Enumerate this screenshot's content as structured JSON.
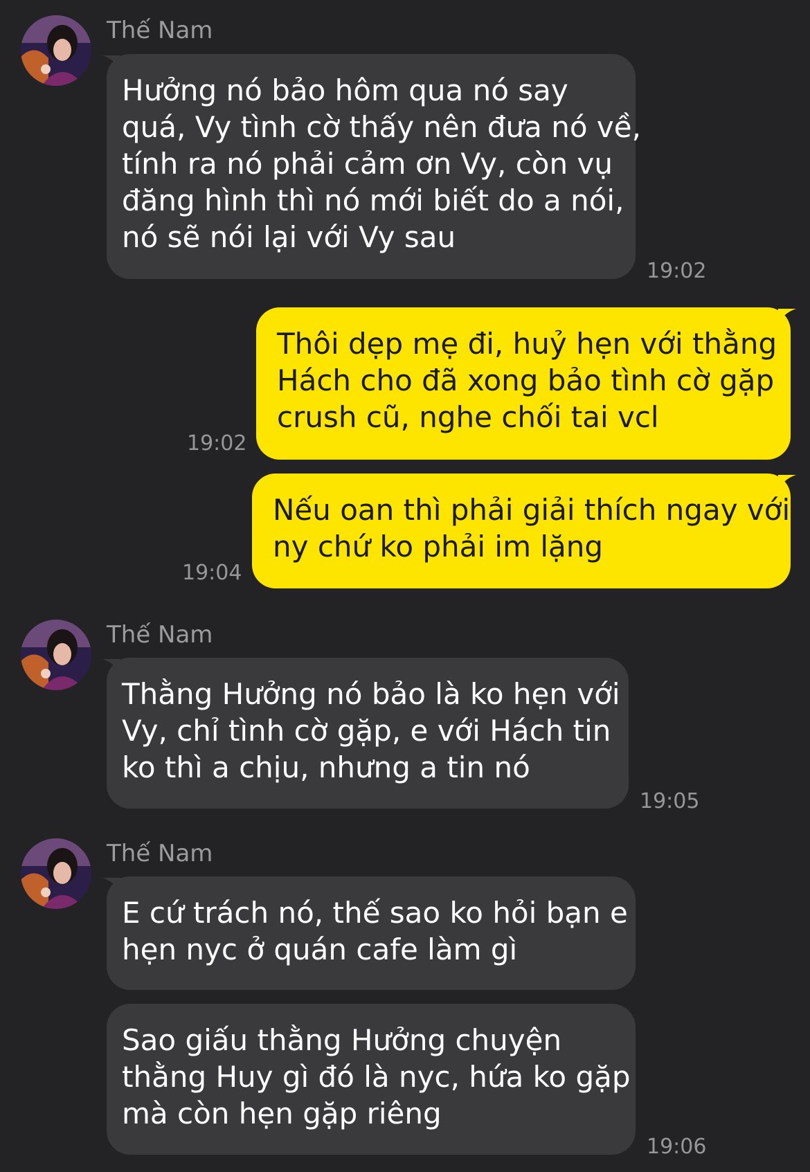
{
  "colors": {
    "background": "#232325",
    "incoming_bubble": "#3a3a3c",
    "outgoing_bubble": "#fee500",
    "timestamp": "#96969b",
    "sender_name": "#9b9ba0"
  },
  "messages": [
    {
      "direction": "incoming",
      "sender": "Thế Nam",
      "lines": [
        "Hưởng nó bảo hôm qua nó say",
        "quá, Vy tình cờ thấy nên đưa nó về,",
        "tính ra nó phải cảm ơn Vy, còn vụ",
        "đăng hình thì nó mới biết do a nói,",
        "nó sẽ nói lại với Vy sau"
      ],
      "time": "19:02"
    },
    {
      "direction": "outgoing",
      "lines": [
        "Thôi dẹp mẹ đi, huỷ hẹn với thằng",
        "Hách cho đã xong bảo tình cờ gặp",
        "crush cũ, nghe chối tai vcl"
      ],
      "time": "19:02"
    },
    {
      "direction": "outgoing",
      "lines": [
        "Nếu oan thì phải giải thích ngay với",
        "ny chứ ko phải im lặng"
      ],
      "time": "19:04"
    },
    {
      "direction": "incoming",
      "sender": "Thế Nam",
      "lines": [
        "Thằng Hưởng nó bảo là ko hẹn với",
        "Vy, chỉ tình cờ gặp, e với Hách tin",
        "ko thì a chịu, nhưng a tin nó"
      ],
      "time": "19:05"
    },
    {
      "direction": "incoming",
      "sender": "Thế Nam",
      "lines": [
        "E cứ trách nó, thế sao ko hỏi bạn e",
        "hẹn nyc ở quán cafe làm gì"
      ],
      "time": ""
    },
    {
      "direction": "incoming",
      "lines": [
        "Sao giấu thằng Hưởng chuyện",
        "thằng Huy gì đó là nyc, hứa ko gặp",
        "mà còn hẹn gặp riêng"
      ],
      "time": "19:06"
    }
  ]
}
